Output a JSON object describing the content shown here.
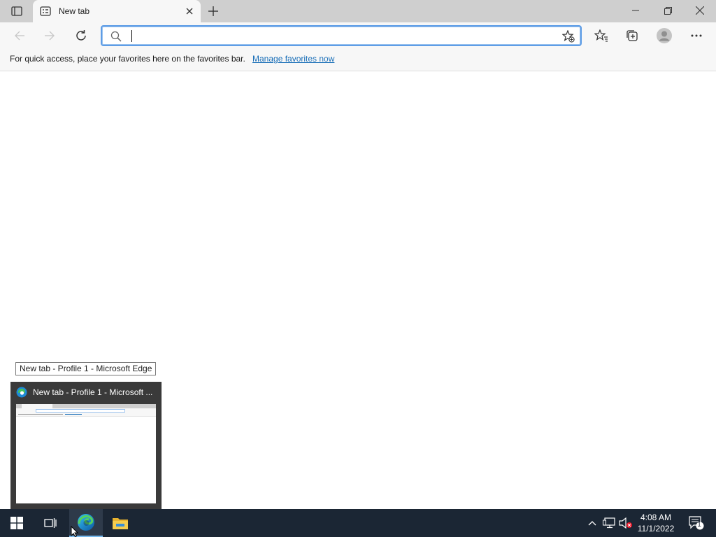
{
  "browser": {
    "tab": {
      "title": "New tab"
    },
    "address_bar": {
      "value": "",
      "placeholder": ""
    },
    "favorites_bar": {
      "message": "For quick access, place your favorites here on the favorites bar.",
      "link": "Manage favorites now"
    }
  },
  "tooltip": {
    "text": "New tab - Profile 1 - Microsoft Edge"
  },
  "preview": {
    "title": "New tab - Profile 1 - Microsoft ..."
  },
  "taskbar": {
    "clock": {
      "time": "4:08 AM",
      "date": "11/1/2022"
    },
    "notifications_count": "1"
  },
  "icons": {
    "tab_actions": "tab-actions-icon",
    "back": "back-arrow-icon",
    "forward": "forward-arrow-icon",
    "refresh": "refresh-icon",
    "search": "search-icon",
    "add_favorite": "add-favorite-star-icon",
    "favorites": "favorites-icon",
    "collections": "collections-icon",
    "profile": "profile-avatar-icon",
    "more": "more-menu-icon",
    "start": "windows-start-icon",
    "task_view": "task-view-icon",
    "edge": "edge-icon",
    "file_explorer": "file-explorer-icon"
  },
  "colors": {
    "accent": "#5e9de6",
    "link": "#1a6fb8",
    "taskbar": "#1b2634",
    "tabstrip": "#cfcfcf"
  }
}
